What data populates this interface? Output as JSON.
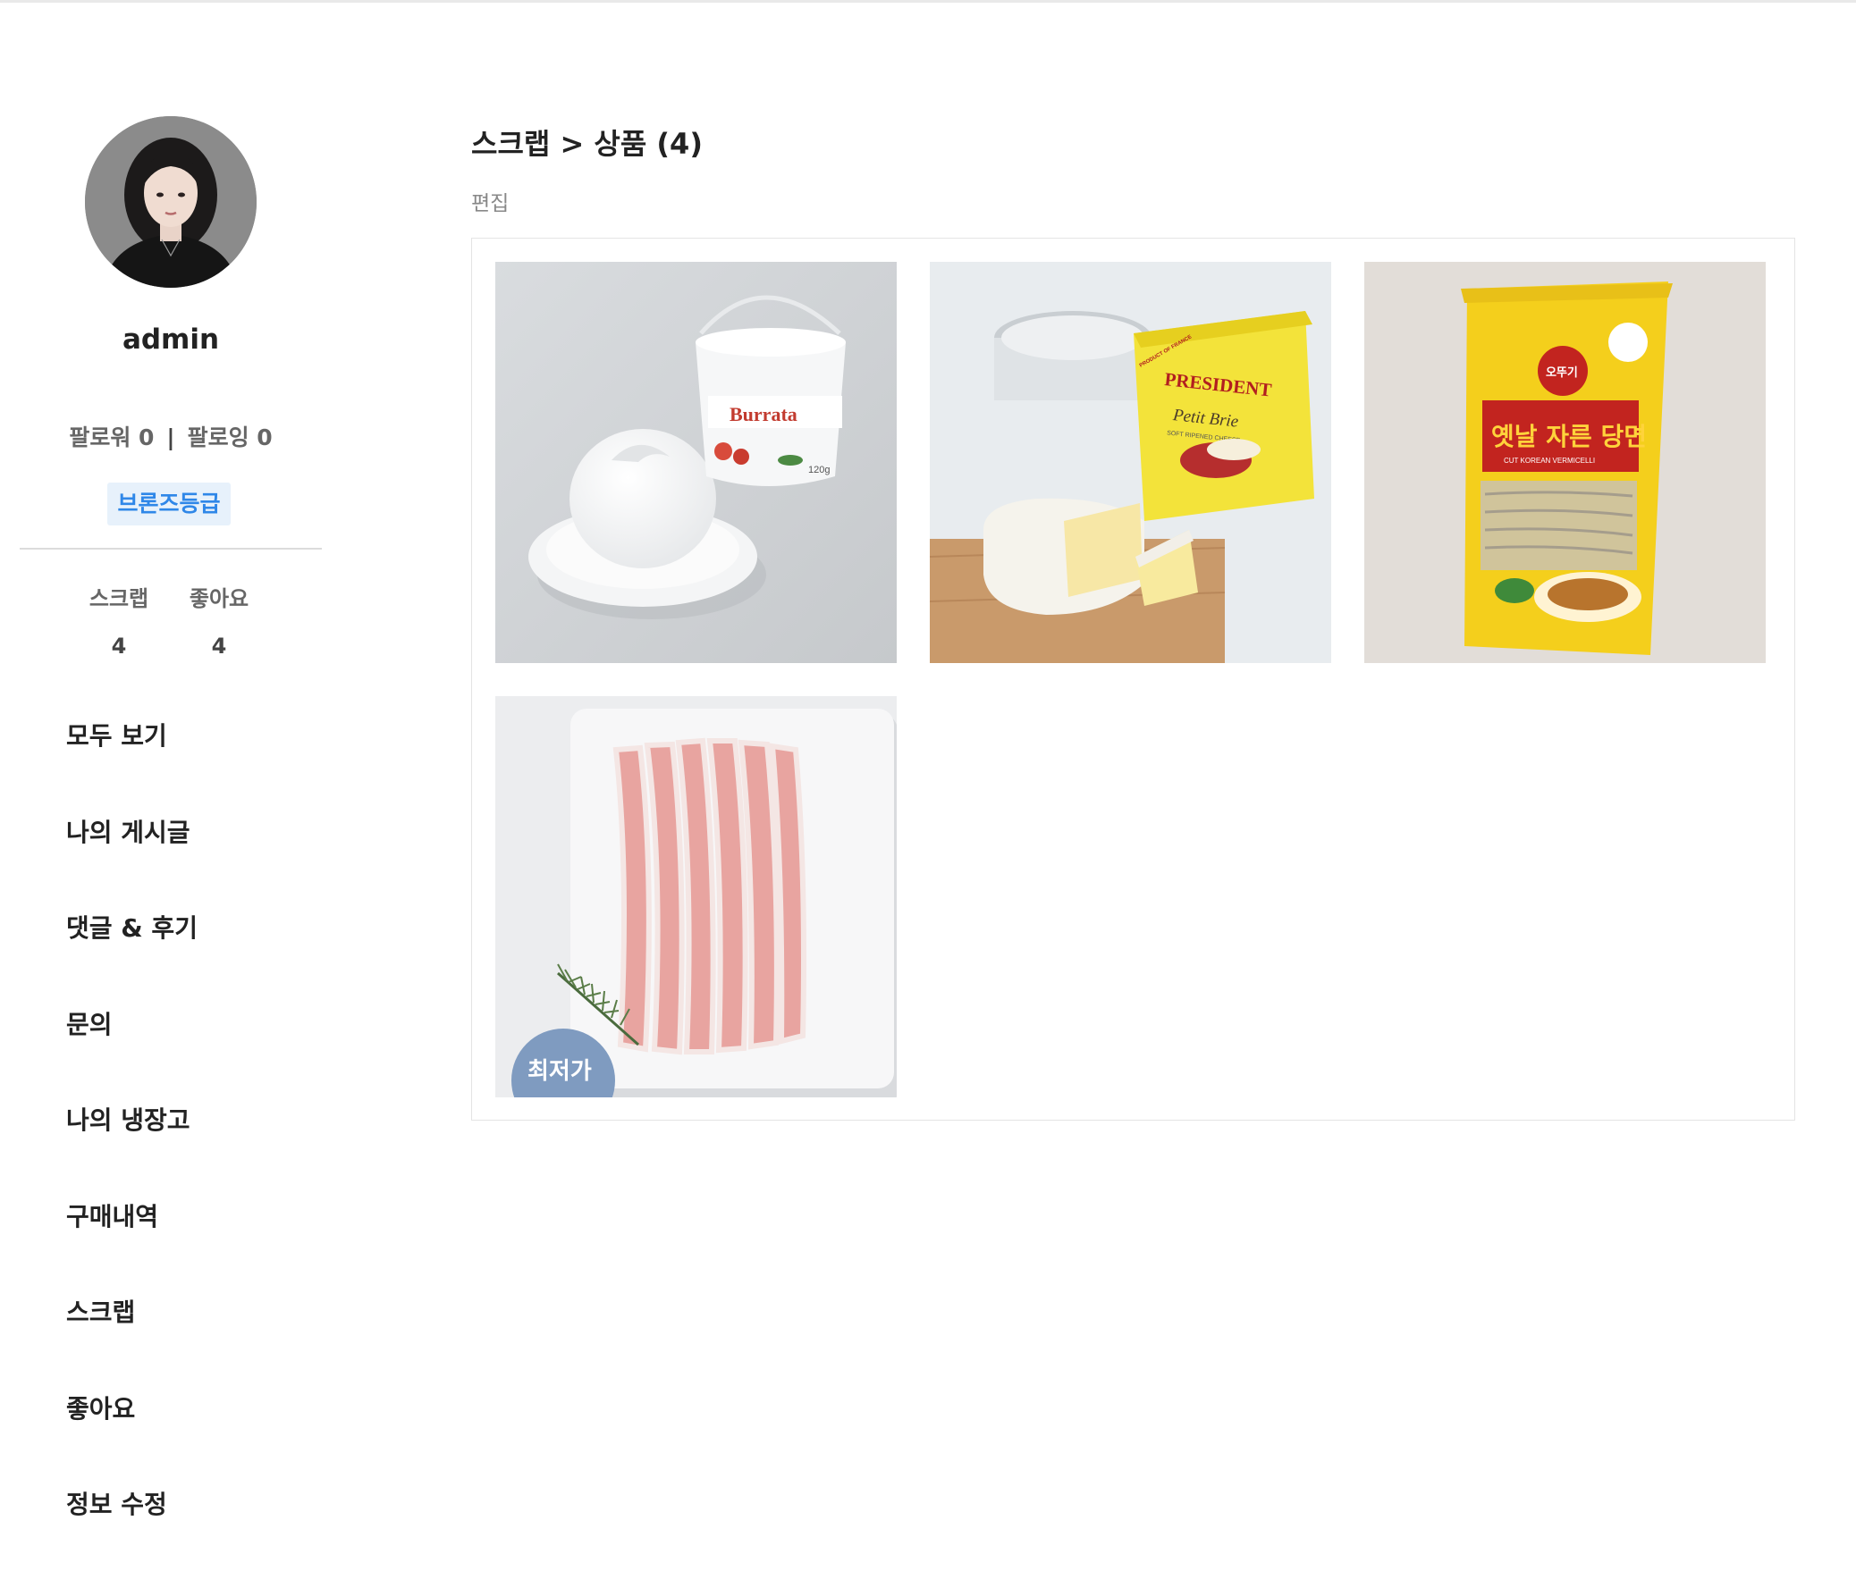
{
  "profile": {
    "username": "admin",
    "follower_label": "팔로워 0",
    "separator": "|",
    "following_label": "팔로잉 0",
    "grade": "브론즈등급",
    "grade_color": "#2f87e8"
  },
  "stats": {
    "scrap_label": "스크랩",
    "scrap_count": "4",
    "like_label": "좋아요",
    "like_count": "4"
  },
  "menu": {
    "items": [
      {
        "label": "모두 보기"
      },
      {
        "label": "나의 게시글"
      },
      {
        "label": "댓글 & 후기"
      },
      {
        "label": "문의"
      },
      {
        "label": "나의 냉장고"
      },
      {
        "label": "구매내역"
      },
      {
        "label": "스크랩"
      },
      {
        "label": "좋아요"
      },
      {
        "label": "정보 수정"
      }
    ]
  },
  "main": {
    "breadcrumb": "스크랩 > 상품 (4)",
    "edit_label": "편집",
    "products": [
      {
        "image": "burrata-cheese",
        "package_text": "Burrata",
        "weight": "120g"
      },
      {
        "image": "petit-brie-cheese",
        "brand": "PRESIDENT",
        "package_text": "Petit Brie",
        "sub_text": "SOFT RIPENED CHEESE",
        "origin": "PRODUCT OF FRANCE"
      },
      {
        "image": "glass-noodles",
        "brand": "오뚜기",
        "package_text": "옛날 자른 당면",
        "sub_text": "CUT KOREAN VERMICELLI"
      },
      {
        "image": "pork-belly",
        "badge": "최저가"
      }
    ]
  }
}
